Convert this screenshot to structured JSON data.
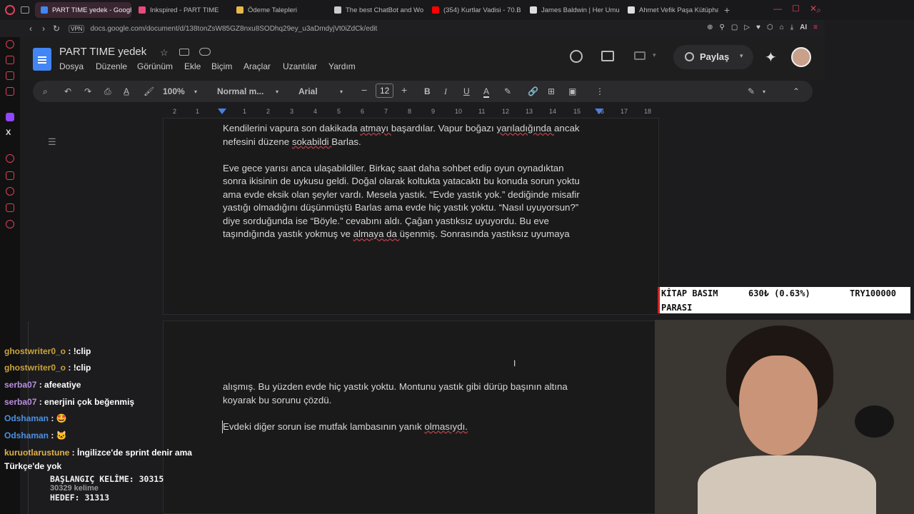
{
  "browser": {
    "tabs": [
      {
        "label": "PART TIME yedek - Google",
        "active": true,
        "color": "#4285f4"
      },
      {
        "label": "Inkspired - PART TIME",
        "active": false,
        "color": "#e84a7a"
      },
      {
        "label": "Ödeme Talepleri",
        "active": false,
        "color": "#e8b84a"
      },
      {
        "label": "The best ChatBot and Wo",
        "active": false,
        "color": "#cccccc"
      },
      {
        "label": "(354) Kurtlar Vadisi - 70.B",
        "active": false,
        "color": "#ff0000"
      },
      {
        "label": "James Baldwin | Her Umu",
        "active": false,
        "color": "#dddddd"
      },
      {
        "label": "Ahmet Vefik Paşa Kütüpha",
        "active": false,
        "color": "#dddddd"
      }
    ],
    "new_tab": "+",
    "url": "docs.google.com/document/d/138tonZsW85GZ8nxu8SODhq29ey_u3aDmdyjVt0iZdCk/edit",
    "vpn": "VPN",
    "ai_label": "AI"
  },
  "docs": {
    "title": "PART TIME  yedek",
    "menu": [
      "Dosya",
      "Düzenle",
      "Görünüm",
      "Ekle",
      "Biçim",
      "Araçlar",
      "Uzantılar",
      "Yardım"
    ],
    "share_label": "Paylaş",
    "zoom": "100%",
    "style": "Normal m...",
    "font": "Arial",
    "font_size": "12",
    "ruler": [
      "2",
      "1",
      "1",
      "2",
      "3",
      "4",
      "5",
      "6",
      "7",
      "8",
      "9",
      "10",
      "11",
      "12",
      "13",
      "14",
      "15",
      "16",
      "17",
      "18"
    ]
  },
  "document": {
    "page1_lines": [
      "Kendilerini vapura son dakikada atmayı başardılar. Vapur boğazı yarıladığında ancak",
      "nefesini düzene sokabildi Barlas.",
      "",
      "Eve gece yarısı anca ulaşabildiler. Birkaç saat daha sohbet edip oyun oynadıktan",
      "sonra ikisinin de uykusu geldi. Doğal olarak koltukta yatacaktı bu konuda sorun yoktu",
      "ama evde eksik olan şeyler vardı. Mesela yastık. “Evde yastık yok.” dediğinde misafir",
      "yastığı olmadığını düşünmüştü Barlas ama evde hiç yastık yoktu. “Nasıl uyuyorsun?”",
      "diye sorduğunda ise “Böyle.” cevabını aldı. Çağan yastıksız uyuyordu. Bu eve",
      "taşındığında yastık yokmuş ve almaya da üşenmiş. Sonrasında yastıksız uyumaya"
    ],
    "page2_lines": [
      "alışmış. Bu yüzden evde hiç yastık yoktu. Montunu yastık gibi dürüp başının altına",
      "koyarak bu sorunu çözdü.",
      "",
      "Evdeki diğer sorun ise mutfak lambasının yanık olmasıydı."
    ]
  },
  "overlay": {
    "label1": "KİTAP BASIM",
    "label2": "PARASI",
    "amount": "630₺ (0.63%)",
    "goal": "TRY100000"
  },
  "chat": [
    {
      "user": "ghostwriter0_o",
      "text": "!clip",
      "color": "#c9a33a"
    },
    {
      "user": "ghostwriter0_o",
      "text": "!clip",
      "color": "#c9a33a"
    },
    {
      "user": "serba07",
      "text": "afeeatiye",
      "color": "#b98fe0"
    },
    {
      "user": "serba07",
      "text": "enerjini çok beğenmiş",
      "color": "#b98fe0"
    },
    {
      "user": "Odshaman",
      "text": "🤩",
      "color": "#4a90e2"
    },
    {
      "user": "Odshaman",
      "text": "🐱",
      "color": "#4a90e2"
    },
    {
      "user": "kuruotlarustune",
      "text": "İngilizce'de sprint denir ama",
      "color": "#e0b34a"
    },
    {
      "user": "",
      "text": "Türkçe'de yok",
      "color": "#ffffff"
    }
  ],
  "counter": {
    "start": "BAŞLANGIÇ KELİME: 30315",
    "words": "30329 kelime",
    "goal": "HEDEF: 31313"
  }
}
